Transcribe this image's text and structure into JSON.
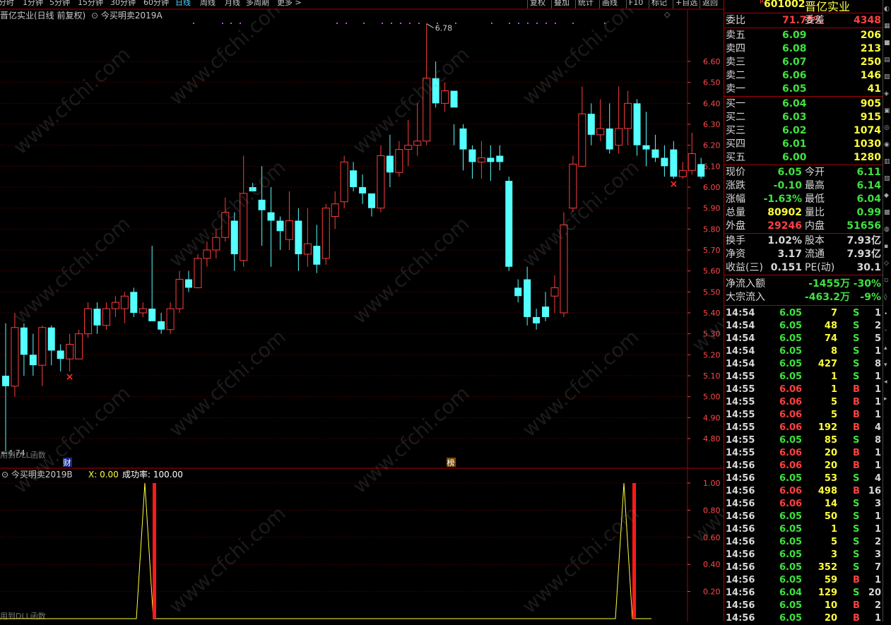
{
  "toolbar": {
    "timeframes": [
      "分时",
      "1分钟",
      "5分钟",
      "15分钟",
      "30分钟",
      "60分钟",
      "日线",
      "周线",
      "月线",
      "多周期",
      "更多 >"
    ],
    "active": "日线",
    "right_buttons": [
      "复权",
      "叠加",
      "统计",
      "画线",
      "F10",
      "标记",
      "+自选",
      "返回"
    ]
  },
  "main_title": {
    "name": "晋亿实业(日线 前复权)",
    "indicator": "今买明卖2019A"
  },
  "high_label": "6.78",
  "low_label": "4.74",
  "note1": "用到DLL函数",
  "badges": {
    "cai": "财",
    "bang": "榜"
  },
  "sub_title": {
    "name": "今买明卖2019B",
    "x": "X: 0.00",
    "rate": "成功率: 100.00"
  },
  "note2": "用到DLL函数",
  "watermark": "www.cfchi.com",
  "axis_main": [
    "6.60",
    "6.50",
    "6.40",
    "6.30",
    "6.20",
    "6.10",
    "6.00",
    "5.90",
    "5.80",
    "5.70",
    "5.60",
    "5.50",
    "5.40",
    "5.30",
    "5.20",
    "5.10",
    "5.00",
    "4.90",
    "4.80"
  ],
  "axis_sub": [
    "1.00",
    "0.80",
    "0.60",
    "0.40",
    "0.20"
  ],
  "colors": {
    "up": "#ff3d3d",
    "down": "#54ffff",
    "grid": "#7a0000",
    "axis": "#ff4a4a",
    "signal": "#ffff3c"
  },
  "chart_data": {
    "type": "candlestick",
    "y_range": [
      4.74,
      6.78
    ],
    "candles": [
      [
        5.1,
        5.35,
        4.74,
        5.05
      ],
      [
        5.05,
        5.4,
        5.0,
        5.33
      ],
      [
        5.33,
        5.35,
        5.1,
        5.2
      ],
      [
        5.2,
        5.3,
        5.1,
        5.15
      ],
      [
        5.15,
        5.34,
        5.05,
        5.33
      ],
      [
        5.33,
        5.34,
        5.15,
        5.22
      ],
      [
        5.22,
        5.25,
        5.12,
        5.18
      ],
      [
        5.18,
        5.3,
        5.12,
        5.25
      ],
      [
        5.18,
        5.32,
        5.18,
        5.3
      ],
      [
        5.3,
        5.45,
        5.28,
        5.42
      ],
      [
        5.42,
        5.45,
        5.3,
        5.34
      ],
      [
        5.34,
        5.45,
        5.32,
        5.42
      ],
      [
        5.42,
        5.48,
        5.38,
        5.45
      ],
      [
        5.42,
        5.5,
        5.35,
        5.48
      ],
      [
        5.5,
        5.52,
        5.38,
        5.4
      ],
      [
        5.4,
        5.45,
        5.38,
        5.42
      ],
      [
        5.42,
        5.72,
        5.38,
        5.36
      ],
      [
        5.36,
        5.4,
        5.3,
        5.32
      ],
      [
        5.32,
        5.45,
        5.3,
        5.42
      ],
      [
        5.42,
        5.6,
        5.4,
        5.56
      ],
      [
        5.56,
        5.6,
        5.5,
        5.52
      ],
      [
        5.52,
        5.68,
        5.52,
        5.66
      ],
      [
        5.66,
        5.74,
        5.62,
        5.7
      ],
      [
        5.7,
        5.8,
        5.66,
        5.76
      ],
      [
        5.76,
        5.95,
        5.74,
        5.88
      ],
      [
        5.84,
        5.88,
        5.6,
        5.68
      ],
      [
        5.65,
        6.15,
        5.62,
        5.97
      ],
      [
        6.0,
        6.02,
        5.98,
        5.98
      ],
      [
        5.94,
        6.1,
        5.72,
        5.89
      ],
      [
        5.88,
        6.0,
        5.62,
        5.84
      ],
      [
        5.84,
        5.86,
        5.7,
        5.79
      ],
      [
        5.75,
        5.98,
        5.7,
        5.84
      ],
      [
        5.84,
        5.9,
        5.6,
        5.68
      ],
      [
        5.68,
        5.9,
        5.62,
        5.73
      ],
      [
        5.72,
        5.82,
        5.59,
        5.63
      ],
      [
        5.66,
        5.92,
        5.63,
        5.9
      ],
      [
        5.86,
        5.98,
        5.8,
        5.92
      ],
      [
        5.93,
        6.15,
        5.9,
        6.12
      ],
      [
        6.08,
        6.12,
        5.98,
        6.0
      ],
      [
        6.0,
        6.06,
        5.92,
        5.97
      ],
      [
        5.97,
        5.92,
        5.86,
        5.9
      ],
      [
        5.9,
        6.2,
        5.88,
        6.15
      ],
      [
        6.15,
        6.25,
        6.0,
        6.07
      ],
      [
        6.07,
        6.22,
        6.05,
        6.18
      ],
      [
        6.18,
        6.32,
        6.1,
        6.2
      ],
      [
        6.2,
        6.4,
        6.15,
        6.22
      ],
      [
        6.22,
        6.78,
        6.2,
        6.52
      ],
      [
        6.52,
        6.6,
        6.38,
        6.4
      ],
      [
        6.4,
        6.5,
        6.36,
        6.46
      ],
      [
        6.46,
        6.3,
        6.2,
        6.38
      ],
      [
        6.28,
        6.3,
        6.08,
        6.18
      ],
      [
        6.18,
        6.2,
        6.04,
        6.12
      ],
      [
        6.12,
        6.22,
        6.04,
        6.14
      ],
      [
        6.14,
        6.2,
        6.03,
        6.12
      ],
      [
        6.15,
        6.2,
        6.08,
        6.12
      ],
      [
        6.03,
        6.05,
        5.6,
        5.62
      ],
      [
        5.52,
        5.56,
        5.45,
        5.48
      ],
      [
        5.56,
        5.62,
        5.34,
        5.38
      ],
      [
        5.38,
        5.42,
        5.32,
        5.35
      ],
      [
        5.43,
        5.5,
        5.36,
        5.38
      ],
      [
        5.48,
        5.58,
        5.4,
        5.52
      ],
      [
        5.4,
        5.88,
        5.38,
        5.82
      ],
      [
        5.9,
        6.15,
        5.88,
        6.11
      ],
      [
        6.1,
        6.48,
        6.1,
        6.35
      ],
      [
        6.35,
        6.4,
        6.2,
        6.25
      ],
      [
        6.25,
        6.42,
        6.22,
        6.28
      ],
      [
        6.28,
        6.4,
        6.16,
        6.18
      ],
      [
        6.2,
        6.48,
        6.16,
        6.28
      ],
      [
        6.28,
        6.46,
        6.2,
        6.4
      ],
      [
        6.4,
        6.42,
        6.15,
        6.2
      ],
      [
        6.2,
        6.36,
        6.1,
        6.18
      ],
      [
        6.18,
        6.25,
        6.12,
        6.14
      ],
      [
        6.14,
        6.2,
        6.05,
        6.1
      ],
      [
        6.18,
        6.22,
        6.04,
        6.05
      ],
      [
        6.05,
        6.12,
        6.04,
        6.08
      ],
      [
        6.08,
        6.26,
        6.06,
        6.16
      ],
      [
        6.11,
        6.14,
        6.04,
        6.05
      ]
    ],
    "sell_markers": [
      7,
      73
    ],
    "sub_series": {
      "peaks": [
        {
          "x": 205,
          "y": 1.0
        },
        {
          "x": 883,
          "y": 1.0
        }
      ],
      "bars": [
        218,
        897
      ]
    }
  },
  "side": {
    "code": "601002",
    "name": "晋亿实业",
    "weibi_label": "委比",
    "weibi": "71.75%",
    "weicha_label": "委差",
    "weicha": "4348",
    "asks": [
      {
        "label": "卖五",
        "price": "6.09",
        "vol": "206"
      },
      {
        "label": "卖四",
        "price": "6.08",
        "vol": "213"
      },
      {
        "label": "卖三",
        "price": "6.07",
        "vol": "250"
      },
      {
        "label": "卖二",
        "price": "6.06",
        "vol": "146"
      },
      {
        "label": "卖一",
        "price": "6.05",
        "vol": "41"
      }
    ],
    "bids": [
      {
        "label": "买一",
        "price": "6.04",
        "vol": "905"
      },
      {
        "label": "买二",
        "price": "6.03",
        "vol": "915"
      },
      {
        "label": "买三",
        "price": "6.02",
        "vol": "1074"
      },
      {
        "label": "买四",
        "price": "6.01",
        "vol": "1030"
      },
      {
        "label": "买五",
        "price": "6.00",
        "vol": "1280"
      }
    ],
    "stats": [
      {
        "l1": "现价",
        "v1": "6.05",
        "c1": "g",
        "l2": "今开",
        "v2": "6.11",
        "c2": "g"
      },
      {
        "l1": "涨跌",
        "v1": "-0.10",
        "c1": "g",
        "l2": "最高",
        "v2": "6.14",
        "c2": "g"
      },
      {
        "l1": "涨幅",
        "v1": "-1.63%",
        "c1": "g",
        "l2": "最低",
        "v2": "6.04",
        "c2": "g"
      },
      {
        "l1": "总量",
        "v1": "80902",
        "c1": "y",
        "l2": "量比",
        "v2": "0.99",
        "c2": "g"
      },
      {
        "l1": "外盘",
        "v1": "29246",
        "c1": "r",
        "l2": "内盘",
        "v2": "51656",
        "c2": "g"
      }
    ],
    "stats2": [
      {
        "l1": "换手",
        "v1": "1.02%",
        "c1": "w",
        "l2": "股本",
        "v2": "7.93亿",
        "c2": "w"
      },
      {
        "l1": "净资",
        "v1": "3.17",
        "c1": "w",
        "l2": "流通",
        "v2": "7.93亿",
        "c2": "w"
      },
      {
        "l1": "收益(三)",
        "v1": "0.151",
        "c1": "w",
        "l2": "PE(动)",
        "v2": "30.1",
        "c2": "w"
      }
    ],
    "flows": [
      {
        "label": "净流入额",
        "v1": "-1455万",
        "v2": "-30%"
      },
      {
        "label": "大宗流入",
        "v1": "-463.2万",
        "v2": "-9%"
      }
    ],
    "ticks": [
      [
        "14:54",
        "6.05",
        "7",
        "S",
        "1"
      ],
      [
        "14:54",
        "6.05",
        "48",
        "S",
        "2"
      ],
      [
        "14:54",
        "6.05",
        "74",
        "S",
        "5"
      ],
      [
        "14:54",
        "6.05",
        "8",
        "S",
        "1"
      ],
      [
        "14:54",
        "6.05",
        "427",
        "S",
        "8"
      ],
      [
        "14:55",
        "6.05",
        "1",
        "S",
        "1"
      ],
      [
        "14:55",
        "6.06",
        "1",
        "B",
        "1"
      ],
      [
        "14:55",
        "6.06",
        "5",
        "B",
        "1"
      ],
      [
        "14:55",
        "6.06",
        "5",
        "B",
        "1"
      ],
      [
        "14:55",
        "6.06",
        "192",
        "B",
        "4"
      ],
      [
        "14:55",
        "6.05",
        "85",
        "S",
        "8"
      ],
      [
        "14:55",
        "6.06",
        "20",
        "B",
        "1"
      ],
      [
        "14:56",
        "6.06",
        "20",
        "B",
        "1"
      ],
      [
        "14:56",
        "6.05",
        "53",
        "S",
        "4"
      ],
      [
        "14:56",
        "6.06",
        "498",
        "B",
        "16"
      ],
      [
        "14:56",
        "6.06",
        "14",
        "S",
        "3"
      ],
      [
        "14:56",
        "6.05",
        "50",
        "S",
        "1"
      ],
      [
        "14:56",
        "6.05",
        "1",
        "S",
        "1"
      ],
      [
        "14:56",
        "6.05",
        "5",
        "S",
        "2"
      ],
      [
        "14:56",
        "6.05",
        "3",
        "S",
        "3"
      ],
      [
        "14:56",
        "6.05",
        "352",
        "S",
        "7"
      ],
      [
        "14:56",
        "6.05",
        "59",
        "B",
        "1"
      ],
      [
        "14:56",
        "6.04",
        "129",
        "S",
        "20"
      ],
      [
        "14:56",
        "6.05",
        "10",
        "B",
        "2"
      ],
      [
        "14:56",
        "6.05",
        "20",
        "B",
        "1"
      ]
    ]
  }
}
